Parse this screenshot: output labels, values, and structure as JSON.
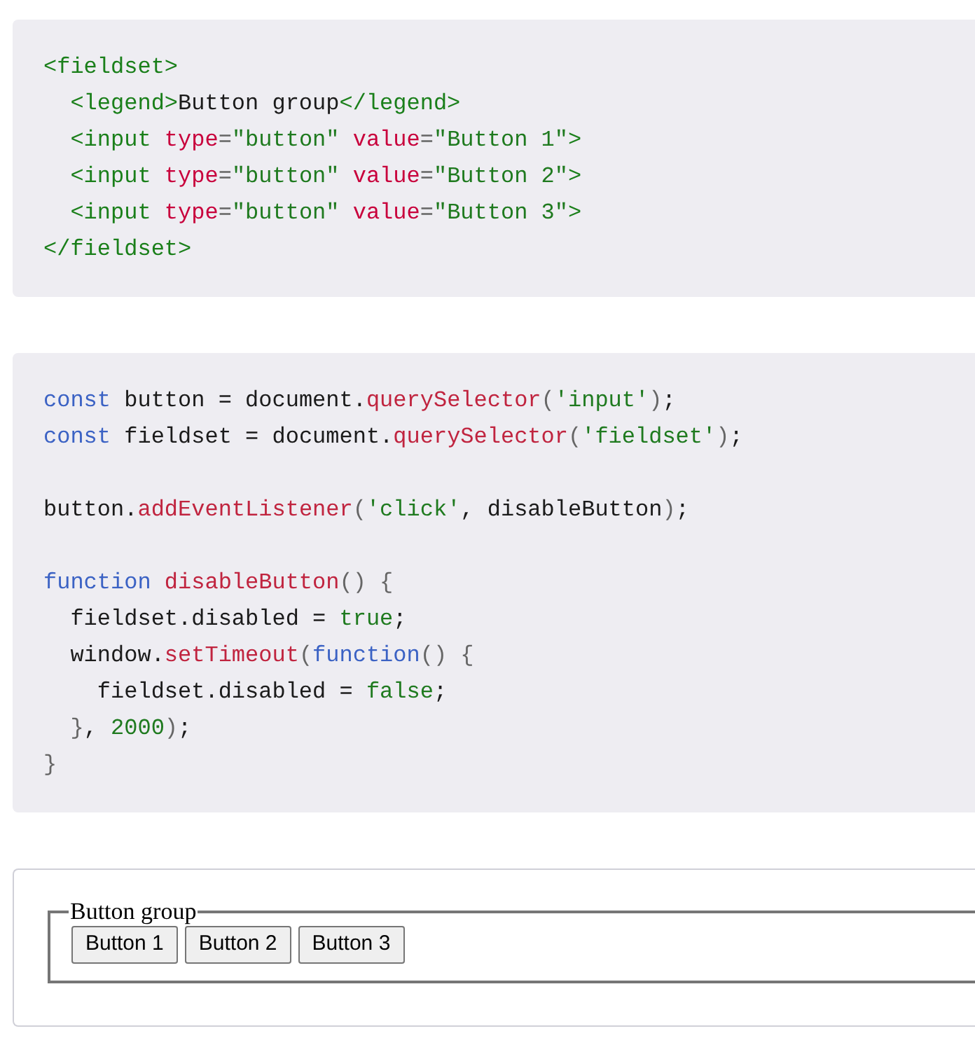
{
  "code_blocks": [
    {
      "lines": [
        {
          "kind": "code",
          "tokens": [
            {
              "kind": "tag",
              "text": "<fieldset>"
            }
          ]
        },
        {
          "kind": "code",
          "tokens": [
            {
              "kind": "tag",
              "text": "  <legend>"
            },
            {
              "kind": "text",
              "text": "Button group"
            },
            {
              "kind": "tag",
              "text": "</legend>"
            }
          ]
        },
        {
          "kind": "code",
          "tokens": [
            {
              "kind": "tag",
              "text": "  <input"
            },
            {
              "kind": "attr",
              "text": " type"
            },
            {
              "kind": "punct",
              "text": "="
            },
            {
              "kind": "str",
              "text": "\"button\""
            },
            {
              "kind": "attr",
              "text": " value"
            },
            {
              "kind": "punct",
              "text": "="
            },
            {
              "kind": "str",
              "text": "\"Button 1\""
            },
            {
              "kind": "tag",
              "text": ">"
            }
          ]
        },
        {
          "kind": "code",
          "tokens": [
            {
              "kind": "tag",
              "text": "  <input"
            },
            {
              "kind": "attr",
              "text": " type"
            },
            {
              "kind": "punct",
              "text": "="
            },
            {
              "kind": "str",
              "text": "\"button\""
            },
            {
              "kind": "attr",
              "text": " value"
            },
            {
              "kind": "punct",
              "text": "="
            },
            {
              "kind": "str",
              "text": "\"Button 2\""
            },
            {
              "kind": "tag",
              "text": ">"
            }
          ]
        },
        {
          "kind": "code",
          "tokens": [
            {
              "kind": "tag",
              "text": "  <input"
            },
            {
              "kind": "attr",
              "text": " type"
            },
            {
              "kind": "punct",
              "text": "="
            },
            {
              "kind": "str",
              "text": "\"button\""
            },
            {
              "kind": "attr",
              "text": " value"
            },
            {
              "kind": "punct",
              "text": "="
            },
            {
              "kind": "str",
              "text": "\"Button 3\""
            },
            {
              "kind": "tag",
              "text": ">"
            }
          ]
        },
        {
          "kind": "code",
          "tokens": [
            {
              "kind": "tag",
              "text": "</fieldset>"
            }
          ]
        }
      ]
    },
    {
      "lines": [
        {
          "kind": "code",
          "tokens": [
            {
              "kind": "kw",
              "text": "const"
            },
            {
              "kind": "text",
              "text": " button = document."
            },
            {
              "kind": "fn",
              "text": "querySelector"
            },
            {
              "kind": "punct",
              "text": "("
            },
            {
              "kind": "str",
              "text": "'input'"
            },
            {
              "kind": "punct",
              "text": ")"
            },
            {
              "kind": "text",
              "text": ";"
            }
          ]
        },
        {
          "kind": "code",
          "tokens": [
            {
              "kind": "kw",
              "text": "const"
            },
            {
              "kind": "text",
              "text": " fieldset = document."
            },
            {
              "kind": "fn",
              "text": "querySelector"
            },
            {
              "kind": "punct",
              "text": "("
            },
            {
              "kind": "str",
              "text": "'fieldset'"
            },
            {
              "kind": "punct",
              "text": ")"
            },
            {
              "kind": "text",
              "text": ";"
            }
          ]
        },
        {
          "kind": "blank"
        },
        {
          "kind": "code",
          "tokens": [
            {
              "kind": "text",
              "text": "button."
            },
            {
              "kind": "fn",
              "text": "addEventListener"
            },
            {
              "kind": "punct",
              "text": "("
            },
            {
              "kind": "str",
              "text": "'click'"
            },
            {
              "kind": "text",
              "text": ", disableButton"
            },
            {
              "kind": "punct",
              "text": ")"
            },
            {
              "kind": "text",
              "text": ";"
            }
          ]
        },
        {
          "kind": "blank"
        },
        {
          "kind": "code",
          "tokens": [
            {
              "kind": "kw",
              "text": "function"
            },
            {
              "kind": "fn",
              "text": " disableButton"
            },
            {
              "kind": "punct",
              "text": "() {"
            }
          ]
        },
        {
          "kind": "code",
          "tokens": [
            {
              "kind": "text",
              "text": "  fieldset.disabled = "
            },
            {
              "kind": "str",
              "text": "true"
            },
            {
              "kind": "text",
              "text": ";"
            }
          ]
        },
        {
          "kind": "code",
          "tokens": [
            {
              "kind": "text",
              "text": "  window."
            },
            {
              "kind": "fn",
              "text": "setTimeout"
            },
            {
              "kind": "punct",
              "text": "("
            },
            {
              "kind": "kw",
              "text": "function"
            },
            {
              "kind": "punct",
              "text": "() {"
            }
          ]
        },
        {
          "kind": "code",
          "tokens": [
            {
              "kind": "text",
              "text": "    fieldset.disabled = "
            },
            {
              "kind": "str",
              "text": "false"
            },
            {
              "kind": "text",
              "text": ";"
            }
          ]
        },
        {
          "kind": "code",
          "tokens": [
            {
              "kind": "punct",
              "text": "  }"
            },
            {
              "kind": "text",
              "text": ", "
            },
            {
              "kind": "str",
              "text": "2000"
            },
            {
              "kind": "punct",
              "text": ")"
            },
            {
              "kind": "text",
              "text": ";"
            }
          ]
        },
        {
          "kind": "code",
          "tokens": [
            {
              "kind": "punct",
              "text": "}"
            }
          ]
        }
      ]
    }
  ],
  "demo": {
    "legend": "Button group",
    "buttons": [
      "Button 1",
      "Button 2",
      "Button 3"
    ]
  }
}
